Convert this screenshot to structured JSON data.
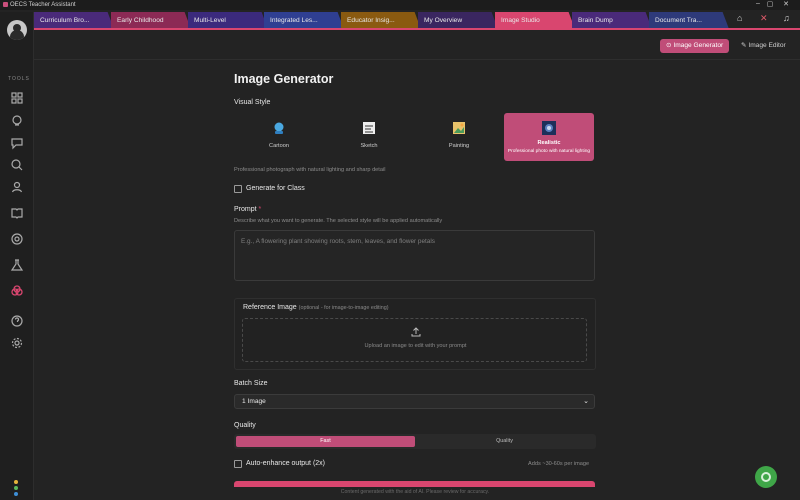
{
  "window": {
    "title": "OECS Teacher Assistant",
    "minimize": "–",
    "maximize": "▢",
    "close": "✕"
  },
  "tabs": [
    {
      "label": "Curriculum Bro...",
      "color": "#4a2a7a"
    },
    {
      "label": "Early Childhood",
      "color": "#8c2a55"
    },
    {
      "label": "Multi-Level",
      "color": "#3b2a7d"
    },
    {
      "label": "Integrated Les...",
      "color": "#2f3f92"
    },
    {
      "label": "Educator Insig...",
      "color": "#8a5a10"
    },
    {
      "label": "My Overview",
      "color": "#3a2660"
    },
    {
      "label": "Image Studio",
      "color": "#d9466f"
    },
    {
      "label": "Brain Dump",
      "color": "#4a2a7a"
    },
    {
      "label": "Document Tra...",
      "color": "#2e3a7a"
    }
  ],
  "header": {
    "generator_label": "Image Generator",
    "editor_label": "Image Editor"
  },
  "sidebar": {
    "tools_label": "TOOLS"
  },
  "main": {
    "title": "Image Generator",
    "visual_style_label": "Visual Style",
    "styles": [
      {
        "name": "Cartoon",
        "icon": "cartoon-icon"
      },
      {
        "name": "Sketch",
        "icon": "sketch-icon"
      },
      {
        "name": "Painting",
        "icon": "painting-icon"
      },
      {
        "name": "Realistic",
        "icon": "realistic-icon",
        "desc": "Professional photo with natural lighting",
        "selected": true
      }
    ],
    "style_description": "Professional photograph with natural lighting and sharp detail",
    "generate_for_class": "Generate for Class",
    "prompt_label": "Prompt",
    "prompt_required": "*",
    "prompt_help": "Describe what you want to generate. The selected style will be applied automatically",
    "prompt_placeholder": "E.g., A flowering plant showing roots, stem, leaves, and flower petals",
    "reference_label": "Reference Image",
    "reference_optional": "(optional - for image-to-image editing)",
    "upload_text": "Upload an image to edit with your prompt",
    "batch_label": "Batch Size",
    "batch_value": "1 Image",
    "quality_label": "Quality",
    "quality_options": [
      "Fast",
      "Quality"
    ],
    "quality_selected": "Fast",
    "auto_enhance": "Auto-enhance output (2x)",
    "auto_enhance_note": "Adds ~30-60s per image",
    "footer_note": "Content generated with the aid of AI. Please review for accuracy."
  },
  "colors": {
    "accent": "#d9466f",
    "selected_card": "#c04d78",
    "bg": "#232323"
  }
}
